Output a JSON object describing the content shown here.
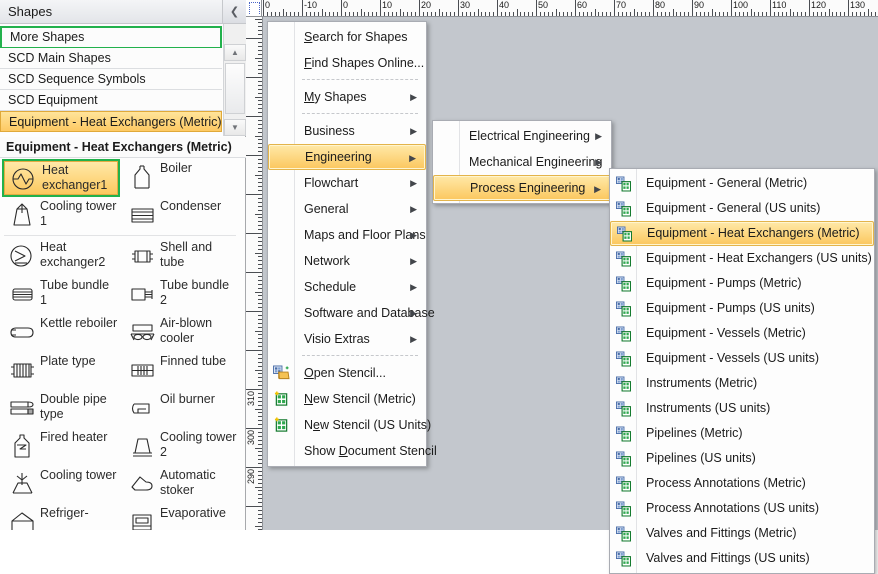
{
  "shapes_panel": {
    "title": "Shapes",
    "collapse_icon": "chevron-left-icon",
    "stencil_rows": [
      {
        "label": "More Shapes",
        "state": "outlined",
        "has_arrow": true
      },
      {
        "label": "SCD Main Shapes",
        "state": "normal",
        "has_arrow": false
      },
      {
        "label": "SCD Sequence Symbols",
        "state": "normal",
        "has_arrow": false
      },
      {
        "label": "SCD Equipment",
        "state": "normal",
        "has_arrow": false
      },
      {
        "label": "Equipment - Heat Exchangers (Metric)",
        "state": "active",
        "has_arrow": false
      }
    ],
    "stencil_caption": "Equipment - Heat Exchangers (Metric)",
    "scroll": {
      "up_icon": "triangle-up-icon",
      "down_icon": "triangle-down-icon",
      "thumb_icon": "grip-icon"
    },
    "shapes": [
      {
        "label": "Heat exchanger1",
        "icon": "heat-exchanger-1-icon",
        "selected": true
      },
      {
        "label": "Boiler",
        "icon": "boiler-icon",
        "selected": false
      },
      {
        "label": "Cooling tower 1",
        "icon": "cooling-tower-1-icon",
        "selected": false
      },
      {
        "label": "Condenser",
        "icon": "condenser-icon",
        "selected": false
      },
      {
        "label": "Heat exchanger2",
        "icon": "heat-exchanger-2-icon",
        "selected": false
      },
      {
        "label": "Shell and tube",
        "icon": "shell-and-tube-icon",
        "selected": false
      },
      {
        "label": "Tube bundle 1",
        "icon": "tube-bundle-1-icon",
        "selected": false
      },
      {
        "label": "Tube bundle 2",
        "icon": "tube-bundle-2-icon",
        "selected": false
      },
      {
        "label": "Kettle reboiler",
        "icon": "kettle-reboiler-icon",
        "selected": false
      },
      {
        "label": "Air-blown cooler",
        "icon": "air-blown-cooler-icon",
        "selected": false
      },
      {
        "label": "Plate type",
        "icon": "plate-type-icon",
        "selected": false
      },
      {
        "label": "Finned tube",
        "icon": "finned-tube-icon",
        "selected": false
      },
      {
        "label": "Double pipe type",
        "icon": "double-pipe-type-icon",
        "selected": false
      },
      {
        "label": "Oil burner",
        "icon": "oil-burner-icon",
        "selected": false
      },
      {
        "label": "Fired heater",
        "icon": "fired-heater-icon",
        "selected": false
      },
      {
        "label": "Cooling tower 2",
        "icon": "cooling-tower-2-icon",
        "selected": false
      },
      {
        "label": "Cooling tower",
        "icon": "cooling-tower-icon",
        "selected": false
      },
      {
        "label": "Automatic stoker",
        "icon": "automatic-stoker-icon",
        "selected": false
      },
      {
        "label": "Refriger-",
        "icon": "refrigerator-icon",
        "selected": false
      },
      {
        "label": "Evaporative",
        "icon": "evaporative-icon",
        "selected": false
      }
    ]
  },
  "rulers": {
    "horizontal_ticks": [
      "0",
      "-10",
      "0",
      "10",
      "20",
      "30",
      "40",
      "50",
      "60",
      "70",
      "80",
      "90",
      "100",
      "110",
      "120",
      "130"
    ],
    "vertical_ticks": [
      "310",
      "300",
      "290"
    ],
    "units": "mm"
  },
  "menu1": {
    "items": [
      {
        "label": "Search for Shapes",
        "accel": "S",
        "submenu": false,
        "icon": null,
        "highlighted": false
      },
      {
        "label": "Find Shapes Online...",
        "accel": "F",
        "submenu": false,
        "icon": null,
        "highlighted": false
      },
      {
        "separator": true
      },
      {
        "label": "My Shapes",
        "accel": "M",
        "submenu": true,
        "icon": null,
        "highlighted": false
      },
      {
        "separator": true
      },
      {
        "label": "Business",
        "accel": null,
        "submenu": true,
        "icon": null,
        "highlighted": false
      },
      {
        "label": "Engineering",
        "accel": null,
        "submenu": true,
        "icon": null,
        "highlighted": true
      },
      {
        "label": "Flowchart",
        "accel": null,
        "submenu": true,
        "icon": null,
        "highlighted": false
      },
      {
        "label": "General",
        "accel": null,
        "submenu": true,
        "icon": null,
        "highlighted": false
      },
      {
        "label": "Maps and Floor Plans",
        "accel": null,
        "submenu": true,
        "icon": null,
        "highlighted": false
      },
      {
        "label": "Network",
        "accel": null,
        "submenu": true,
        "icon": null,
        "highlighted": false
      },
      {
        "label": "Schedule",
        "accel": null,
        "submenu": true,
        "icon": null,
        "highlighted": false
      },
      {
        "label": "Software and Database",
        "accel": null,
        "submenu": true,
        "icon": null,
        "highlighted": false
      },
      {
        "label": "Visio Extras",
        "accel": null,
        "submenu": true,
        "icon": null,
        "highlighted": false
      },
      {
        "separator": true
      },
      {
        "label": "Open Stencil...",
        "accel": "O",
        "submenu": false,
        "icon": "open-stencil-icon",
        "highlighted": false
      },
      {
        "label": "New Stencil (Metric)",
        "accel": "N",
        "submenu": false,
        "icon": "new-stencil-icon",
        "highlighted": false
      },
      {
        "label": "New Stencil (US Units)",
        "accel": "e",
        "submenu": false,
        "icon": "new-stencil-icon",
        "highlighted": false
      },
      {
        "label": "Show Document Stencil",
        "accel": "D",
        "submenu": false,
        "icon": null,
        "highlighted": false
      }
    ]
  },
  "menu2": {
    "items": [
      {
        "label": "Electrical Engineering",
        "submenu": true,
        "highlighted": false
      },
      {
        "label": "Mechanical Engineering",
        "submenu": true,
        "highlighted": false
      },
      {
        "label": "Process Engineering",
        "submenu": true,
        "highlighted": true
      }
    ]
  },
  "menu3": {
    "items": [
      {
        "label": "Equipment - General (Metric)",
        "icon": "stencil-icon",
        "highlighted": false
      },
      {
        "label": "Equipment - General (US units)",
        "icon": "stencil-icon",
        "highlighted": false
      },
      {
        "label": "Equipment - Heat Exchangers (Metric)",
        "icon": "stencil-icon",
        "highlighted": true
      },
      {
        "label": "Equipment - Heat Exchangers (US units)",
        "icon": "stencil-icon",
        "highlighted": false
      },
      {
        "label": "Equipment - Pumps (Metric)",
        "icon": "stencil-icon",
        "highlighted": false
      },
      {
        "label": "Equipment - Pumps (US units)",
        "icon": "stencil-icon",
        "highlighted": false
      },
      {
        "label": "Equipment - Vessels (Metric)",
        "icon": "stencil-icon",
        "highlighted": false
      },
      {
        "label": "Equipment - Vessels (US units)",
        "icon": "stencil-icon",
        "highlighted": false
      },
      {
        "label": "Instruments (Metric)",
        "icon": "stencil-icon",
        "highlighted": false
      },
      {
        "label": "Instruments (US units)",
        "icon": "stencil-icon",
        "highlighted": false
      },
      {
        "label": "Pipelines (Metric)",
        "icon": "stencil-icon",
        "highlighted": false
      },
      {
        "label": "Pipelines (US units)",
        "icon": "stencil-icon",
        "highlighted": false
      },
      {
        "label": "Process Annotations (Metric)",
        "icon": "stencil-icon",
        "highlighted": false
      },
      {
        "label": "Process Annotations (US units)",
        "icon": "stencil-icon",
        "highlighted": false
      },
      {
        "label": "Valves and Fittings (Metric)",
        "icon": "stencil-icon",
        "highlighted": false
      },
      {
        "label": "Valves and Fittings (US units)",
        "icon": "stencil-icon",
        "highlighted": false
      }
    ]
  },
  "colors": {
    "highlight_top": "#ffe9a8",
    "highlight_bottom": "#fbc75e",
    "highlight_border": "#e3b44b",
    "selection_outline": "#22b14c",
    "canvas": "#c3c7cd",
    "panel_border": "#a7a9ac"
  }
}
